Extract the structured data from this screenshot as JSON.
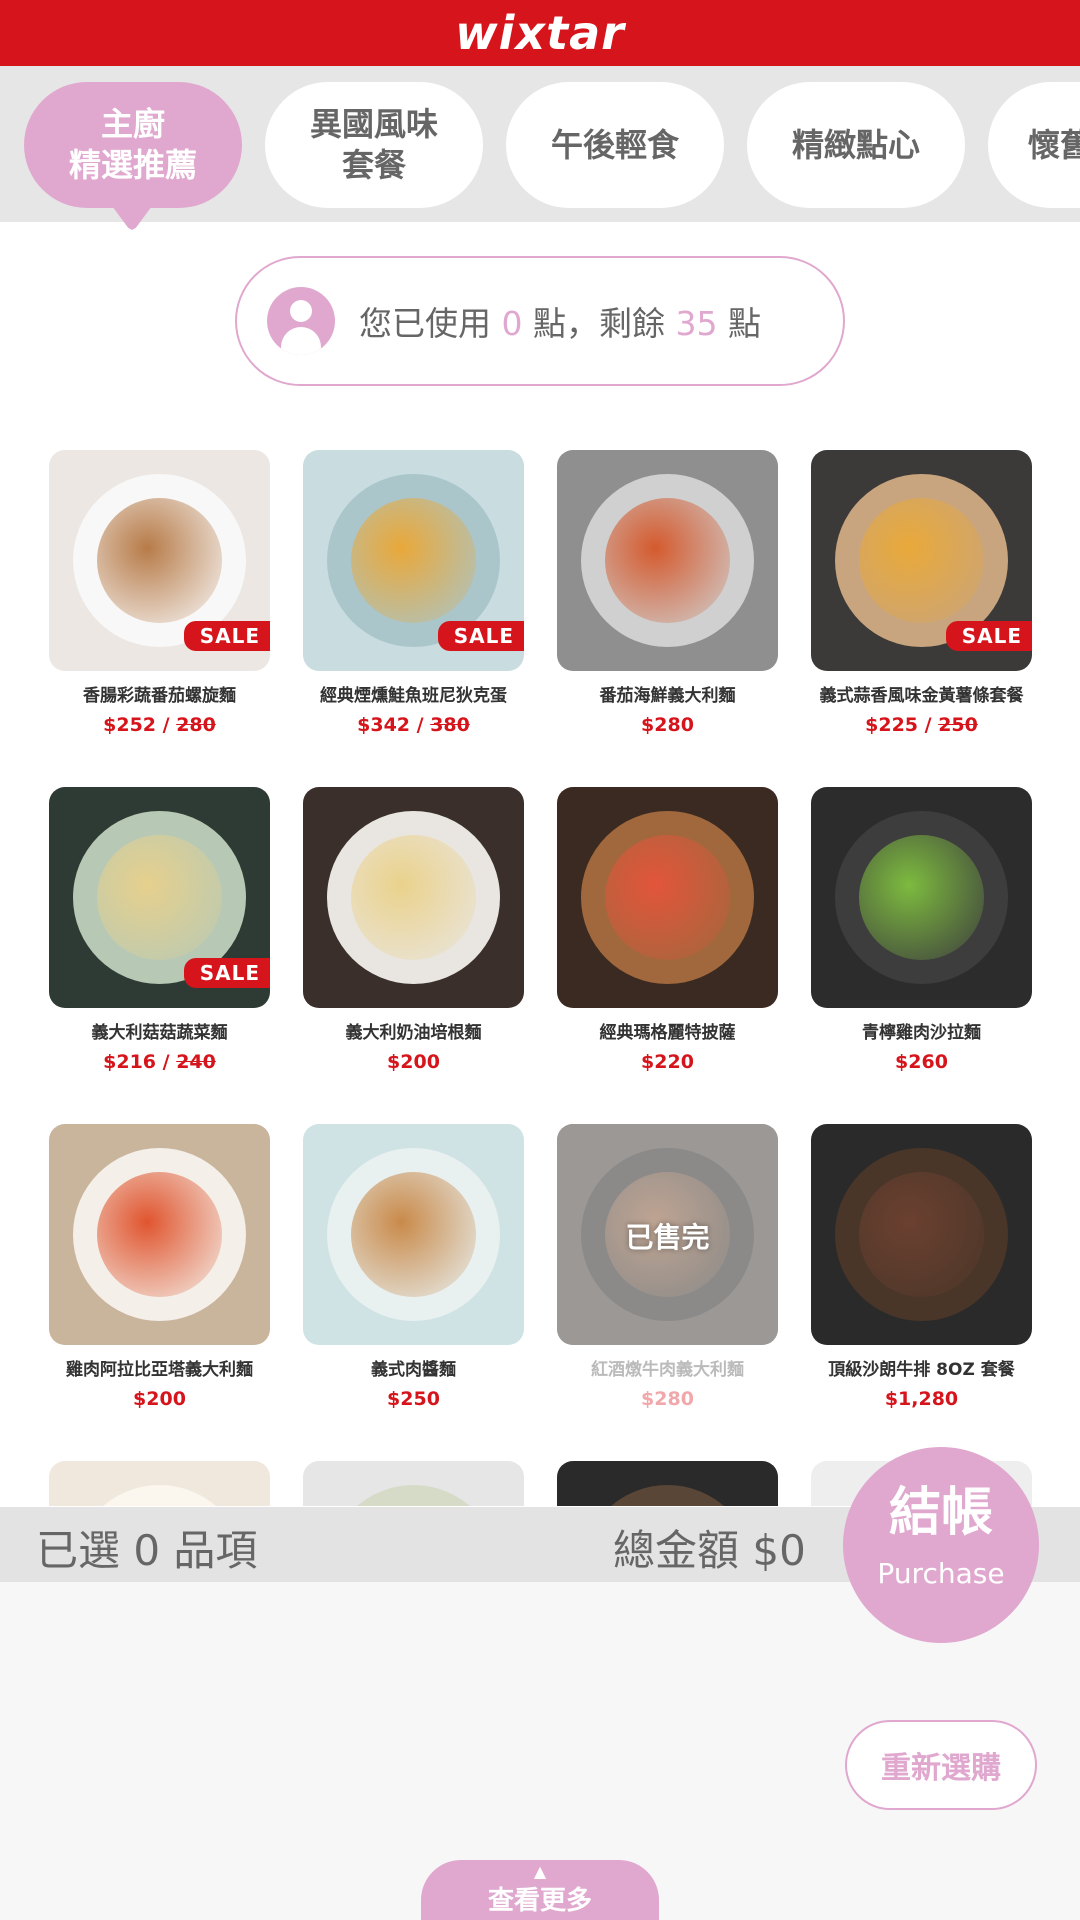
{
  "header": {
    "logo": "wixtar",
    "color": "#d6141b"
  },
  "tabs": [
    {
      "label": "主廚\n精選推薦",
      "active": true
    },
    {
      "label": "異國風味\n套餐",
      "active": false
    },
    {
      "label": "午後輕食",
      "active": false
    },
    {
      "label": "精緻點心",
      "active": false
    },
    {
      "label": "懷舊",
      "active": false
    }
  ],
  "points": {
    "prefix": "您已使用 ",
    "used": "0",
    "middle": " 點，剩餘 ",
    "remaining": "35",
    "suffix": " 點"
  },
  "menu": [
    {
      "name": "香腸彩蔬番茄螺旋麵",
      "price": "$252",
      "orig": "280",
      "sale": true,
      "sold": false,
      "icon": "fusilli-salad-photo",
      "colors": [
        "#ece7e2",
        "#f8f8f8",
        "#b77b48"
      ]
    },
    {
      "name": "經典煙燻鮭魚班尼狄克蛋",
      "price": "$342",
      "orig": "380",
      "sale": true,
      "sold": false,
      "icon": "eggs-benedict-photo",
      "colors": [
        "#c9dde0",
        "#aac6ca",
        "#e9a83a"
      ]
    },
    {
      "name": "番茄海鮮義大利麵",
      "price": "$280",
      "orig": "",
      "sale": false,
      "sold": false,
      "icon": "seafood-pasta-photo",
      "colors": [
        "#8f8f8f",
        "#d0d0d0",
        "#d45a2e"
      ]
    },
    {
      "name": "義式蒜香風味金黃薯條套餐",
      "price": "$225",
      "orig": "250",
      "sale": true,
      "sold": false,
      "icon": "fries-photo",
      "colors": [
        "#3b3a38",
        "#c8a57e",
        "#e9a93a"
      ]
    },
    {
      "name": "義大利菇菇蔬菜麵",
      "price": "$216",
      "orig": "240",
      "sale": true,
      "sold": false,
      "icon": "mushroom-pasta-photo",
      "colors": [
        "#2e3a34",
        "#b7c9b5",
        "#e6d08d"
      ]
    },
    {
      "name": "義大利奶油培根麵",
      "price": "$200",
      "orig": "",
      "sale": false,
      "sold": false,
      "icon": "carbonara-photo",
      "colors": [
        "#3a2f2a",
        "#e9e6e1",
        "#ead28c"
      ]
    },
    {
      "name": "經典瑪格麗特披薩",
      "price": "$220",
      "orig": "",
      "sale": false,
      "sold": false,
      "icon": "pizza-photo",
      "colors": [
        "#3a2a22",
        "#a0683c",
        "#e2553b"
      ]
    },
    {
      "name": "青檸雞肉沙拉麵",
      "price": "$260",
      "orig": "",
      "sale": false,
      "sold": false,
      "icon": "chicken-salad-photo",
      "colors": [
        "#2c2c2c",
        "#3d3d3d",
        "#7dbb3f"
      ]
    },
    {
      "name": "雞肉阿拉比亞塔義大利麵",
      "price": "$200",
      "orig": "",
      "sale": false,
      "sold": false,
      "icon": "arrabbiata-photo",
      "colors": [
        "#c9b49c",
        "#f4efe8",
        "#e0552f"
      ]
    },
    {
      "name": "義式肉醬麵",
      "price": "$250",
      "orig": "",
      "sale": false,
      "sold": false,
      "icon": "bolognese-photo",
      "colors": [
        "#cfe3e4",
        "#e8f0f0",
        "#c98a4a"
      ]
    },
    {
      "name": "紅酒燉牛肉義大利麵",
      "price": "$280",
      "orig": "",
      "sale": false,
      "sold": true,
      "icon": "beef-stew-photo",
      "colors": [
        "#4a4440",
        "#2c2a28",
        "#8a5a3a"
      ]
    },
    {
      "name": "頂級沙朗牛排 8OZ 套餐",
      "price": "$1,280",
      "orig": "",
      "sale": false,
      "sold": false,
      "icon": "steak-photo",
      "colors": [
        "#2a2a2a",
        "#4a3628",
        "#6b4030"
      ]
    },
    {
      "name": "",
      "price": "",
      "orig": "",
      "sale": false,
      "sold": false,
      "icon": "soup-photo",
      "colors": [
        "#f0e8dc",
        "#fbf6ee",
        "#f3e5c8"
      ]
    },
    {
      "name": "",
      "price": "",
      "orig": "",
      "sale": false,
      "sold": false,
      "icon": "pasta-photo",
      "colors": [
        "#e6e6e6",
        "#d6dbc8",
        "#c9b060"
      ]
    },
    {
      "name": "",
      "price": "",
      "orig": "",
      "sale": false,
      "sold": false,
      "icon": "rice-photo",
      "colors": [
        "#2a2a2a",
        "#5a4636",
        "#c08040"
      ]
    },
    {
      "name": "",
      "price": "",
      "orig": "",
      "sale": false,
      "sold": false,
      "icon": "dish-photo",
      "colors": [
        "#eeeeee",
        "#f5f5f5",
        "#e0e0e0"
      ]
    }
  ],
  "labels": {
    "sale": "SALE",
    "sold_out": "已售完",
    "price_sep": " / "
  },
  "cart": {
    "selected": "已選 0 品項",
    "total": "總金額 $0",
    "checkout_big": "結帳",
    "checkout_small": "Purchase"
  },
  "actions": {
    "reset": "重新選購",
    "more": "查看更多"
  },
  "colors": {
    "accent": "#e0a8cf",
    "sale_red": "#d6141b"
  }
}
